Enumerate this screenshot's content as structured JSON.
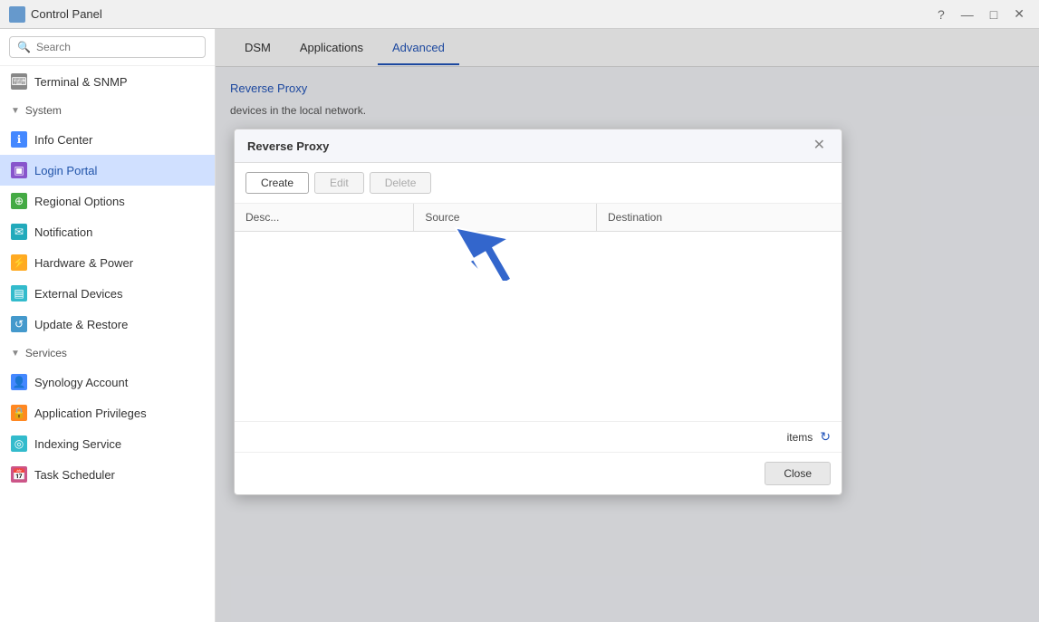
{
  "titlebar": {
    "icon": "cp",
    "title": "Control Panel",
    "help_label": "?",
    "minimize_label": "—",
    "restore_label": "□",
    "close_label": "✕"
  },
  "sidebar": {
    "search_placeholder": "Search",
    "terminal_snmp": "Terminal & SNMP",
    "system_section": "System",
    "items": [
      {
        "id": "info-center",
        "label": "Info Center",
        "icon_class": "icon-blue",
        "icon": "ℹ"
      },
      {
        "id": "login-portal",
        "label": "Login Portal",
        "icon_class": "icon-purple",
        "icon": "▣",
        "active": true
      },
      {
        "id": "regional-options",
        "label": "Regional Options",
        "icon_class": "icon-green",
        "icon": "🌐"
      },
      {
        "id": "notification",
        "label": "Notification",
        "icon_class": "icon-teal",
        "icon": "✉"
      },
      {
        "id": "hardware-power",
        "label": "Hardware & Power",
        "icon_class": "icon-yellow",
        "icon": "⚡"
      },
      {
        "id": "external-devices",
        "label": "External Devices",
        "icon_class": "icon-cyan",
        "icon": "📦"
      },
      {
        "id": "update-restore",
        "label": "Update & Restore",
        "icon_class": "icon-lightblue",
        "icon": "↺"
      }
    ],
    "services_section": "Services",
    "service_items": [
      {
        "id": "synology-account",
        "label": "Synology Account",
        "icon_class": "icon-blue",
        "icon": "👤"
      },
      {
        "id": "application-privileges",
        "label": "Application Privileges",
        "icon_class": "icon-orange",
        "icon": "🔒"
      },
      {
        "id": "indexing-service",
        "label": "Indexing Service",
        "icon_class": "icon-cyan",
        "icon": "🔍"
      },
      {
        "id": "task-scheduler",
        "label": "Task Scheduler",
        "icon_class": "icon-pink",
        "icon": "📅"
      }
    ]
  },
  "tabs": {
    "items": [
      {
        "id": "dsm",
        "label": "DSM"
      },
      {
        "id": "applications",
        "label": "Applications"
      },
      {
        "id": "advanced",
        "label": "Advanced",
        "active": true
      }
    ]
  },
  "breadcrumb": "Reverse Proxy",
  "content_desc": "devices in the local network.",
  "modal": {
    "title": "Reverse Proxy",
    "close_label": "✕",
    "create_label": "Create",
    "edit_label": "Edit",
    "delete_label": "Delete",
    "columns": [
      {
        "id": "desc",
        "label": "Desc..."
      },
      {
        "id": "source",
        "label": "Source"
      },
      {
        "id": "destination",
        "label": "Destination"
      }
    ],
    "items_label": "items",
    "refresh_icon": "↻",
    "close_button_label": "Close"
  }
}
